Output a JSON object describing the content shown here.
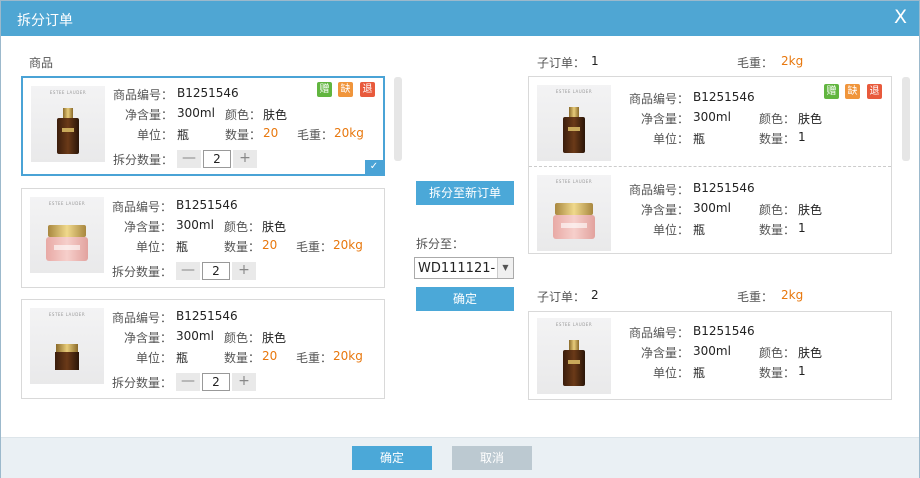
{
  "dialog": {
    "title": "拆分订单",
    "close_glyph": "X"
  },
  "left": {
    "section_label": "商品",
    "labels": {
      "code": "商品编号：",
      "volume": "净含量：",
      "color": "颜色：",
      "unit": "单位：",
      "qty": "数量：",
      "weight": "毛重：",
      "split_qty": "拆分数量："
    },
    "items": [
      {
        "code": "B1251546",
        "volume": "300ml",
        "color": "肤色",
        "unit": "瓶",
        "qty": "20",
        "weight": "20kg",
        "split_qty": "2",
        "image": "serum-bottle",
        "badges": [
          "赠",
          "缺",
          "退"
        ],
        "selected": true
      },
      {
        "code": "B1251546",
        "volume": "300ml",
        "color": "肤色",
        "unit": "瓶",
        "qty": "20",
        "weight": "20kg",
        "split_qty": "2",
        "image": "cream-jar",
        "badges": [],
        "selected": false
      },
      {
        "code": "B1251546",
        "volume": "300ml",
        "color": "肤色",
        "unit": "瓶",
        "qty": "20",
        "weight": "20kg",
        "split_qty": "2",
        "image": "eye-cream-jar",
        "badges": [],
        "selected": false
      }
    ],
    "stepper": {
      "minus": "—",
      "plus": "+"
    }
  },
  "middle": {
    "split_new_label": "拆分至新订单",
    "split_to_label": "拆分至：",
    "split_to_value": "WD111121-",
    "confirm_label": "确定"
  },
  "right": {
    "labels": {
      "suborder": "子订单：",
      "weight": "毛重：",
      "code": "商品编号：",
      "volume": "净含量：",
      "color": "颜色：",
      "unit": "单位：",
      "qty": "数量："
    },
    "suborders": [
      {
        "number": "1",
        "weight": "2kg",
        "items": [
          {
            "code": "B1251546",
            "volume": "300ml",
            "color": "肤色",
            "unit": "瓶",
            "qty": "1",
            "image": "serum-bottle",
            "badges": [
              "赠",
              "缺",
              "退"
            ]
          },
          {
            "code": "B1251546",
            "volume": "300ml",
            "color": "肤色",
            "unit": "瓶",
            "qty": "1",
            "image": "cream-jar",
            "badges": []
          }
        ]
      },
      {
        "number": "2",
        "weight": "2kg",
        "items": [
          {
            "code": "B1251546",
            "volume": "300ml",
            "color": "肤色",
            "unit": "瓶",
            "qty": "1",
            "image": "serum-bottle",
            "badges": []
          }
        ]
      }
    ]
  },
  "footer": {
    "confirm_label": "确定",
    "cancel_label": "取消"
  },
  "colors": {
    "title_bar": "#4fa6d3",
    "accent": "#4aa3d6",
    "orange": "#e8780e",
    "gift": "#61b53f",
    "short": "#f0953b",
    "return": "#e85a3c"
  }
}
